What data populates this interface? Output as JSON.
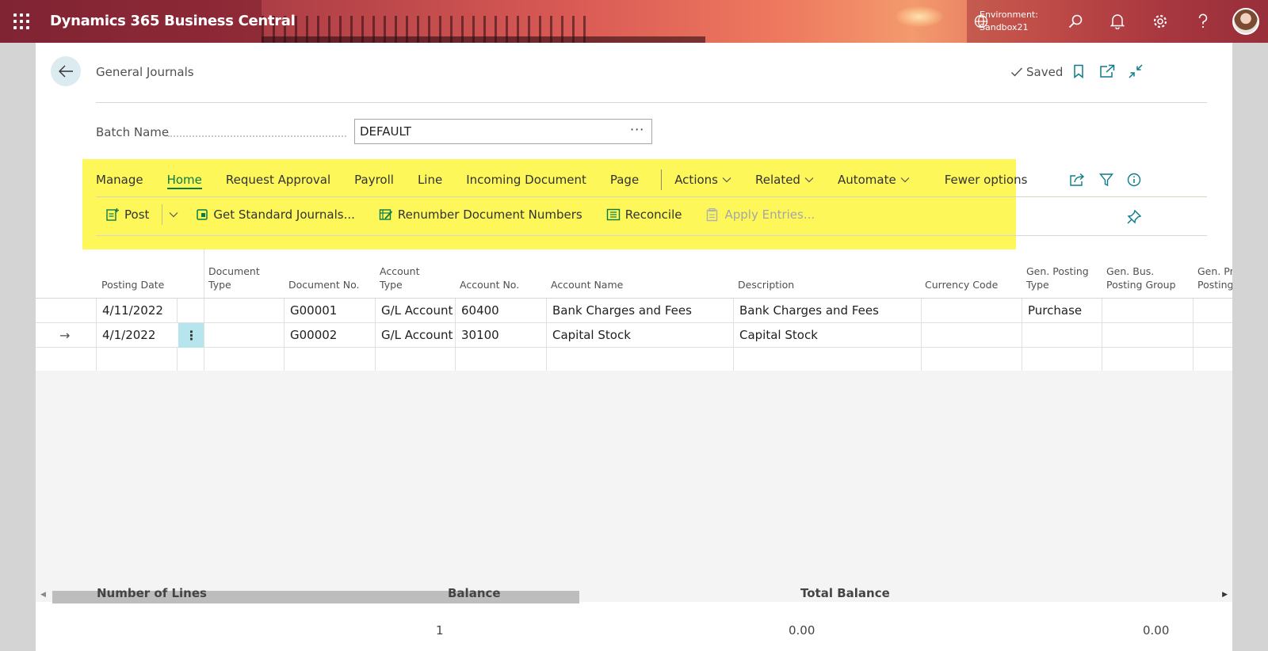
{
  "app": {
    "title": "Dynamics 365 Business Central",
    "environment_label": "Environment:",
    "environment_name": "Sandbox21"
  },
  "page": {
    "title": "General Journals",
    "saved_label": "Saved"
  },
  "batch": {
    "label": "Batch Name",
    "value": "DEFAULT",
    "ellipsis": "···"
  },
  "nav": {
    "manage": "Manage",
    "home": "Home",
    "request_approval": "Request Approval",
    "payroll": "Payroll",
    "line": "Line",
    "incoming_document": "Incoming Document",
    "page": "Page",
    "actions": "Actions",
    "related": "Related",
    "automate": "Automate",
    "fewer_options": "Fewer options"
  },
  "actions": {
    "post": "Post",
    "get_standard_journals": "Get Standard Journals...",
    "renumber": "Renumber Document Numbers",
    "reconcile": "Reconcile",
    "apply_entries": "Apply Entries..."
  },
  "columns": {
    "posting_date": "Posting Date",
    "document_type_1": "Document",
    "document_type_2": "Type",
    "document_no": "Document No.",
    "account_type_1": "Account",
    "account_type_2": "Type",
    "account_no": "Account No.",
    "account_name": "Account Name",
    "description": "Description",
    "currency_code": "Currency Code",
    "gen_posting_type_1": "Gen. Posting",
    "gen_posting_type_2": "Type",
    "gen_bus_posting_group_1": "Gen. Bus.",
    "gen_bus_posting_group_2": "Posting Group",
    "gen_prod_posting_1": "Gen. Pr",
    "gen_prod_posting_2": "Posting"
  },
  "rows": [
    {
      "posting_date": "4/11/2022",
      "document_type": "",
      "document_no": "G00001",
      "account_type": "G/L Account",
      "account_no": "60400",
      "account_name": "Bank Charges and Fees",
      "description": "Bank Charges and Fees",
      "currency_code": "",
      "gen_posting_type": "Purchase",
      "gen_bus_posting_group": ""
    },
    {
      "posting_date": "4/1/2022",
      "document_type": "",
      "document_no": "G00002",
      "account_type": "G/L Account",
      "account_no": "30100",
      "account_name": "Capital Stock",
      "description": "Capital Stock",
      "currency_code": "",
      "gen_posting_type": "",
      "gen_bus_posting_group": "",
      "row_marker": "→",
      "row_menu": "⋮"
    }
  ],
  "footer": {
    "number_of_lines_label": "Number of Lines",
    "number_of_lines_value": "1",
    "balance_label": "Balance",
    "balance_value": "0.00",
    "total_balance_label": "Total Balance",
    "total_balance_value": "0.00"
  },
  "colors": {
    "accent_green": "#0b7a4a",
    "highlight_yellow": "#fdf75a",
    "selected_cell": "#b7e5ed"
  }
}
